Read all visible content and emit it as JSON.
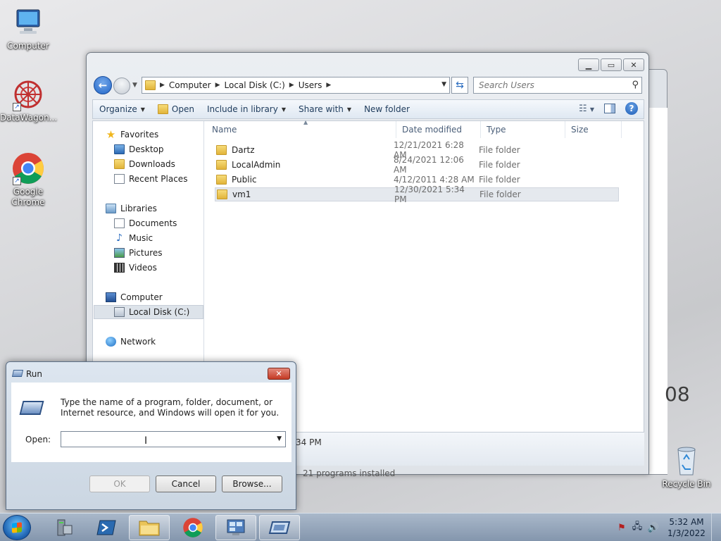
{
  "desktop": {
    "icons": [
      {
        "label": "Computer"
      },
      {
        "label": "DataWagon..."
      },
      {
        "label": "Google Chrome"
      },
      {
        "label": "Recycle Bin"
      }
    ],
    "background_fragments": {
      "text_08": "08",
      "text_pm": "34 PM",
      "text_programs": "21 programs installed"
    }
  },
  "explorer": {
    "breadcrumb": [
      "Computer",
      "Local Disk (C:)",
      "Users"
    ],
    "search_placeholder": "Search Users",
    "toolbar": {
      "organize": "Organize",
      "open": "Open",
      "include_in_library": "Include in library",
      "share_with": "Share with",
      "new_folder": "New folder"
    },
    "nav": {
      "favorites": "Favorites",
      "desktop": "Desktop",
      "downloads": "Downloads",
      "recent_places": "Recent Places",
      "libraries": "Libraries",
      "documents": "Documents",
      "music": "Music",
      "pictures": "Pictures",
      "videos": "Videos",
      "computer": "Computer",
      "local_disk": "Local Disk (C:)",
      "network": "Network"
    },
    "columns": {
      "name": "Name",
      "date": "Date modified",
      "type": "Type",
      "size": "Size"
    },
    "files": [
      {
        "name": "Dartz",
        "date": "12/21/2021 6:28 AM",
        "type": "File folder"
      },
      {
        "name": "LocalAdmin",
        "date": "8/24/2021 12:06 AM",
        "type": "File folder"
      },
      {
        "name": "Public",
        "date": "4/12/2011 4:28 AM",
        "type": "File folder"
      },
      {
        "name": "vm1",
        "date": "12/30/2021 5:34 PM",
        "type": "File folder"
      }
    ]
  },
  "run_dialog": {
    "title": "Run",
    "description": "Type the name of a program, folder, document, or Internet resource, and Windows will open it for you.",
    "open_label": "Open:",
    "open_value": "",
    "ok": "OK",
    "cancel": "Cancel",
    "browse": "Browse..."
  },
  "taskbar": {
    "time": "5:32 AM",
    "date": "1/3/2022"
  },
  "colors": {
    "accent": "#2266c8",
    "close_red": "#c43a24"
  }
}
